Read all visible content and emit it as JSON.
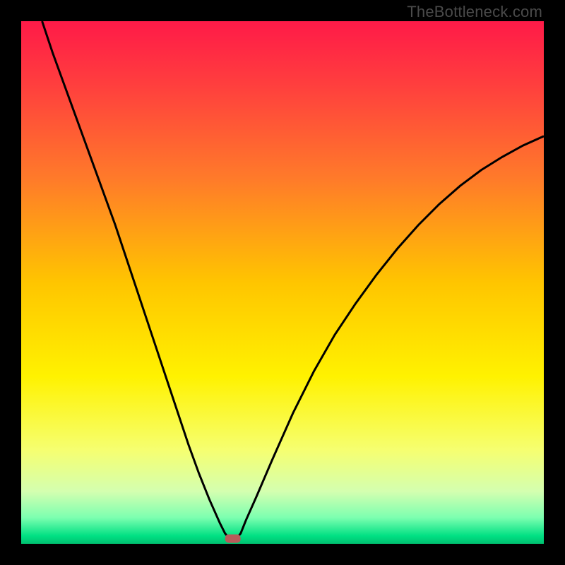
{
  "watermark": "TheBottleneck.com",
  "chart_data": {
    "type": "line",
    "title": "",
    "xlabel": "",
    "ylabel": "",
    "xlim": [
      0,
      100
    ],
    "ylim": [
      0,
      100
    ],
    "background_gradient": {
      "stops": [
        {
          "offset": 0.0,
          "color": "#ff1a48"
        },
        {
          "offset": 0.12,
          "color": "#ff3e3e"
        },
        {
          "offset": 0.3,
          "color": "#ff7a2a"
        },
        {
          "offset": 0.5,
          "color": "#ffc500"
        },
        {
          "offset": 0.68,
          "color": "#fff200"
        },
        {
          "offset": 0.82,
          "color": "#f6ff70"
        },
        {
          "offset": 0.9,
          "color": "#d4ffb0"
        },
        {
          "offset": 0.95,
          "color": "#7cffb0"
        },
        {
          "offset": 0.985,
          "color": "#00e083"
        },
        {
          "offset": 1.0,
          "color": "#00c070"
        }
      ]
    },
    "marker": {
      "x": 40.5,
      "y": 1.0,
      "color": "#b85a5a"
    },
    "series": [
      {
        "name": "curve",
        "color": "#000000",
        "width": 3,
        "x": [
          4,
          6,
          8,
          10,
          12,
          14,
          16,
          18,
          20,
          22,
          24,
          26,
          28,
          30,
          32,
          34,
          36,
          38,
          39,
          40,
          40.5,
          41,
          42,
          43,
          45,
          48,
          52,
          56,
          60,
          64,
          68,
          72,
          76,
          80,
          84,
          88,
          92,
          96,
          100
        ],
        "y": [
          100,
          94,
          88.5,
          83,
          77.5,
          72,
          66.5,
          61,
          55,
          49,
          43,
          37,
          31,
          25,
          19,
          13.5,
          8.5,
          4,
          2,
          0.8,
          0.5,
          0.8,
          2,
          4.5,
          9,
          16,
          25,
          33,
          40,
          46,
          51.5,
          56.5,
          61,
          65,
          68.5,
          71.5,
          74,
          76.2,
          78
        ]
      }
    ]
  }
}
